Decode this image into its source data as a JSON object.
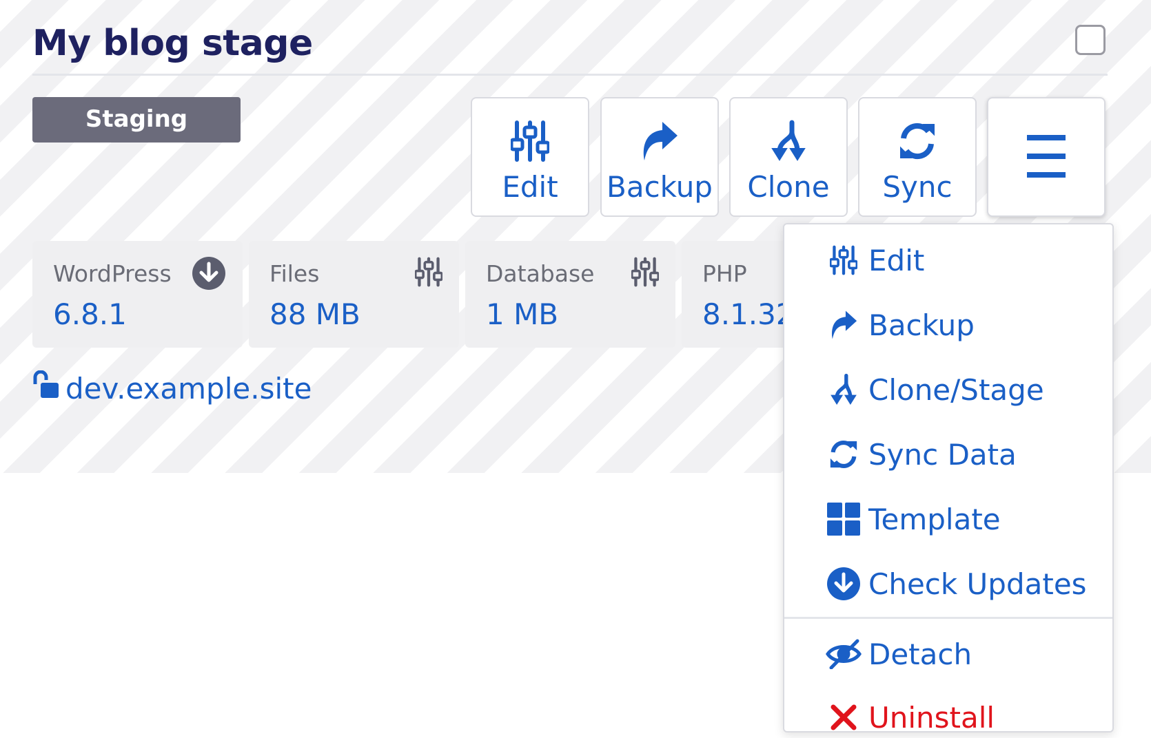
{
  "site": {
    "title": "My blog stage",
    "environment_badge": "Staging",
    "url": "dev.example.site"
  },
  "toolbar": {
    "edit": "Edit",
    "backup": "Backup",
    "clone": "Clone",
    "sync": "Sync"
  },
  "stats": [
    {
      "label": "WordPress",
      "value": "6.8.1",
      "icon": "download-circle-icon"
    },
    {
      "label": "Files",
      "value": "88 MB",
      "icon": "sliders-icon"
    },
    {
      "label": "Database",
      "value": "1 MB",
      "icon": "sliders-icon"
    },
    {
      "label": "PHP",
      "value": "8.1.32"
    }
  ],
  "menu": {
    "items": [
      {
        "label": "Edit",
        "icon": "sliders-icon"
      },
      {
        "label": "Backup",
        "icon": "share-arrow-icon"
      },
      {
        "label": "Clone/Stage",
        "icon": "fork-icon"
      },
      {
        "label": "Sync Data",
        "icon": "sync-icon"
      },
      {
        "label": "Template",
        "icon": "grid-icon"
      },
      {
        "label": "Check Updates",
        "icon": "download-circle-icon"
      },
      {
        "label": "Detach",
        "icon": "eye-slash-icon"
      },
      {
        "label": "Uninstall",
        "icon": "close-icon"
      }
    ]
  },
  "colors": {
    "accent": "#1a5fc6",
    "title": "#1e2160",
    "badge_bg": "#6b6b7b",
    "danger": "#e0141c"
  }
}
